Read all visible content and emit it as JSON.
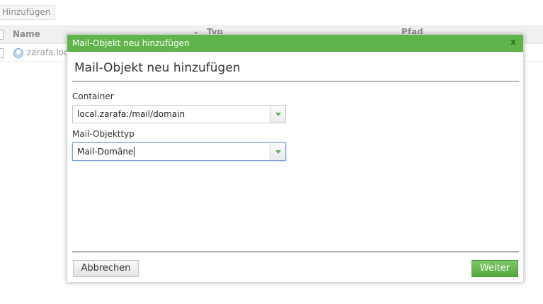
{
  "toolbar": {
    "add_label": "Hinzufügen"
  },
  "grid": {
    "columns": [
      "Name",
      "Typ",
      "Pfad"
    ],
    "rows": [
      {
        "name": "zarafa.loca"
      }
    ]
  },
  "dialog": {
    "window_title": "Mail-Objekt neu hinzufügen",
    "close_glyph": "x",
    "heading": "Mail-Objekt neu hinzufügen",
    "container": {
      "label": "Container",
      "value": "local.zarafa:/mail/domain"
    },
    "object_type": {
      "label": "Mail-Objekttyp",
      "value": "Mail-Domäne"
    },
    "cancel_label": "Abbrechen",
    "next_label": "Weiter"
  },
  "colors": {
    "accent": "#5fb44a",
    "accent_dark": "#4a9a38",
    "focus_border": "#7ea1d6"
  },
  "icons": {
    "combo_arrow": "chevron-down-icon",
    "row_icon": "mail-domain-icon",
    "close": "close-icon"
  }
}
